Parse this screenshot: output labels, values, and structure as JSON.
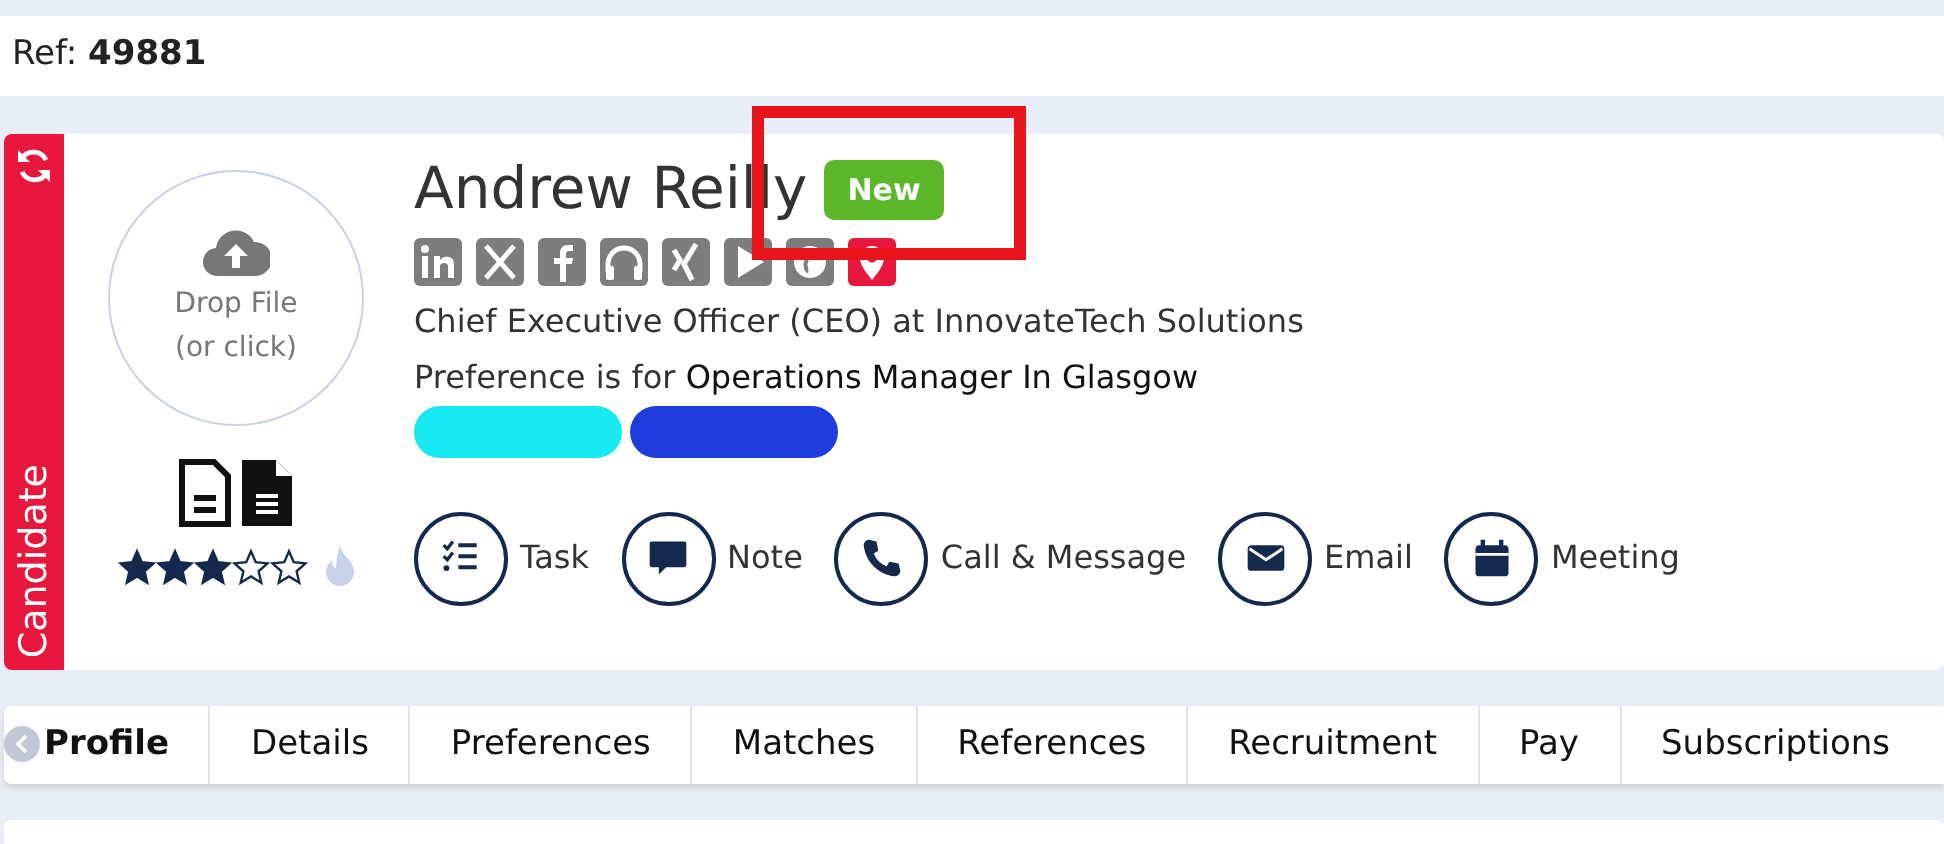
{
  "ref": {
    "label": "Ref:",
    "value": "49881"
  },
  "record": {
    "type_label": "Candidate",
    "name": "Andrew Reilly",
    "badge": "New",
    "dropzone": {
      "line1": "Drop File",
      "line2": "(or click)"
    },
    "stars": 3,
    "headline": "Chief Executive Officer (CEO) at InnovateTech Solutions",
    "preference": {
      "prefix": "Preference is for",
      "value": "Operations Manager In Glasgow"
    },
    "tags": [
      {
        "color": "#18e8ef"
      },
      {
        "color": "#1e3ddc"
      }
    ],
    "actions": [
      {
        "kind": "task",
        "label": "Task"
      },
      {
        "kind": "note",
        "label": "Note"
      },
      {
        "kind": "call",
        "label": "Call & Message"
      },
      {
        "kind": "email",
        "label": "Email"
      },
      {
        "kind": "meeting",
        "label": "Meeting"
      }
    ]
  },
  "tabs": [
    {
      "label": "Profile",
      "selected": true
    },
    {
      "label": "Details",
      "selected": false
    },
    {
      "label": "Preferences",
      "selected": false
    },
    {
      "label": "Matches",
      "selected": false
    },
    {
      "label": "References",
      "selected": false
    },
    {
      "label": "Recruitment",
      "selected": false
    },
    {
      "label": "Pay",
      "selected": false
    },
    {
      "label": "Subscriptions",
      "selected": false
    }
  ]
}
